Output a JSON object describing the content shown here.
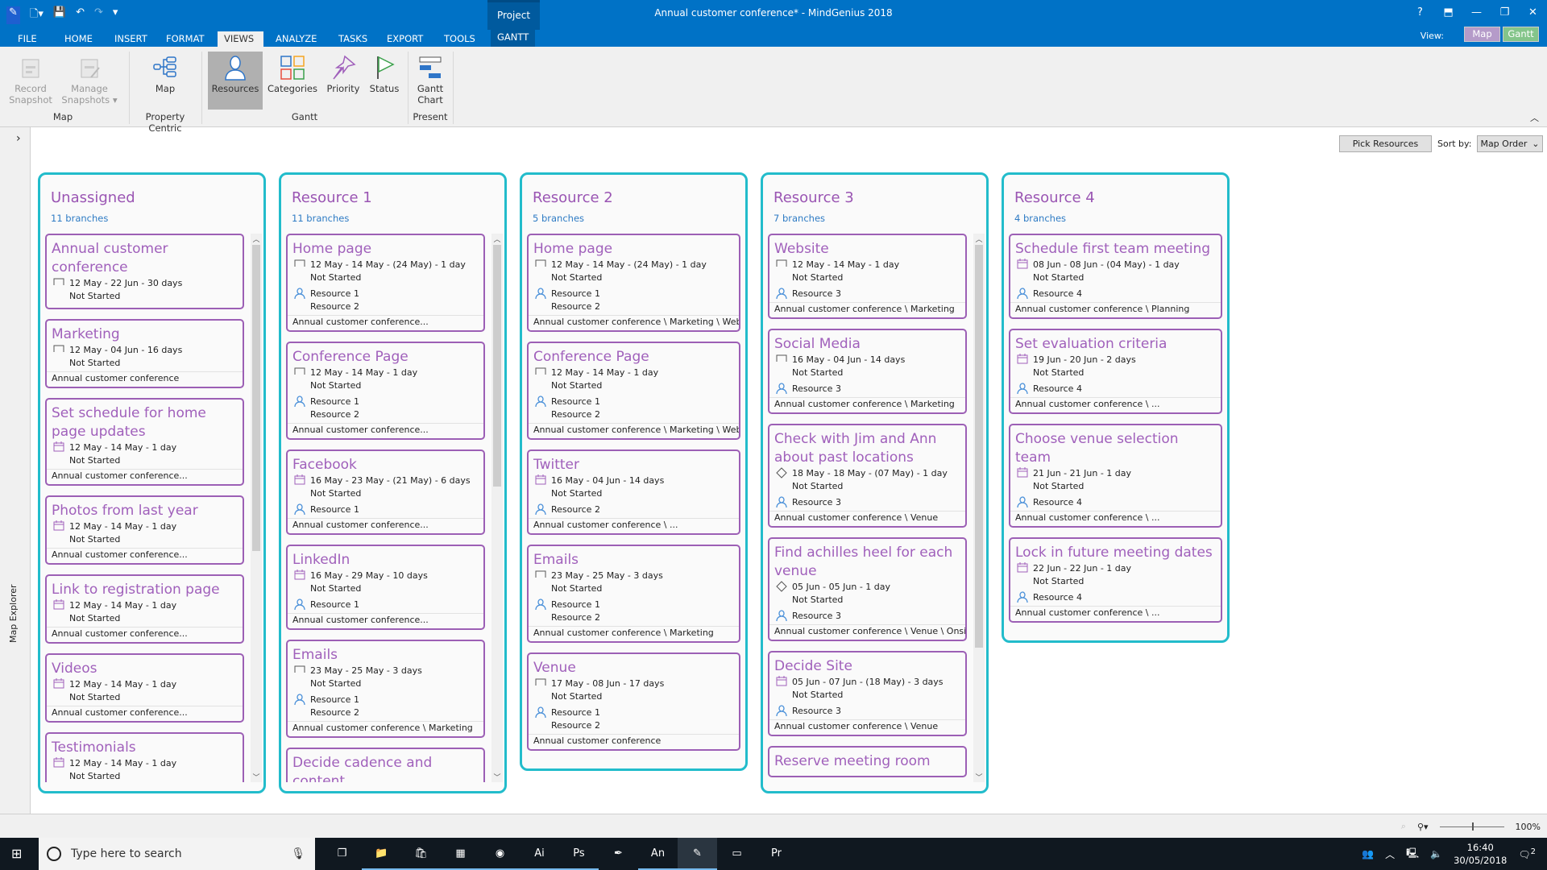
{
  "window": {
    "title": "Annual customer conference* - MindGenius 2018",
    "context_tab": "Project",
    "help": "?",
    "minimize": "—",
    "restore": "❐",
    "close": "✕"
  },
  "tabs": [
    "FILE",
    "HOME",
    "INSERT",
    "FORMAT",
    "VIEWS",
    "ANALYZE",
    "TASKS",
    "EXPORT",
    "TOOLS",
    "GANTT"
  ],
  "active_tab": "VIEWS",
  "view_switch": {
    "label": "View:",
    "map": "Map",
    "gantt": "Gantt",
    "map_color": "#b59bc9",
    "gantt_color": "#84c58a"
  },
  "ribbon": {
    "buttons": [
      {
        "label": "Record Snapshot",
        "icon": "record-snapshot-icon"
      },
      {
        "label": "Manage Snapshots ▾",
        "icon": "manage-snapshots-icon"
      },
      {
        "label": "Map",
        "icon": "map-icon"
      },
      {
        "label": "Resources",
        "icon": "person-icon",
        "selected": true
      },
      {
        "label": "Categories",
        "icon": "categories-icon"
      },
      {
        "label": "Priority",
        "icon": "pin-icon"
      },
      {
        "label": "Status",
        "icon": "flag-icon"
      },
      {
        "label": "Gantt Chart",
        "icon": "gantt-chart-icon"
      }
    ],
    "groups": [
      "Map",
      "Property Centric",
      "Gantt",
      "Present"
    ]
  },
  "explorer": {
    "label": "Map Explorer"
  },
  "toolbar": {
    "pick_resources": "Pick Resources",
    "sort_label": "Sort by:",
    "sort_value": "Map Order"
  },
  "colors": {
    "column_border": "#22bccb",
    "card_border": "#9c5fb5",
    "title": "#a060bb",
    "ribbon_blue": "#0072c6"
  },
  "columns": [
    {
      "name": "Unassigned",
      "count": "11 branches",
      "cards": [
        {
          "title": "Annual customer conference",
          "icon": "bracket",
          "dates": "12 May - 22 Jun - 30 days",
          "status": "Not Started",
          "resources": [],
          "path": ""
        },
        {
          "title": "Marketing",
          "icon": "bracket",
          "dates": "12 May - 04 Jun - 16 days",
          "status": "Not Started",
          "resources": [],
          "path": "Annual customer conference"
        },
        {
          "title": "Set schedule for home page updates",
          "icon": "calendar",
          "dates": "12 May - 14 May - 1 day",
          "status": "Not Started",
          "resources": [],
          "path": "Annual customer conference..."
        },
        {
          "title": "Photos from last year",
          "icon": "calendar",
          "dates": "12 May - 14 May - 1 day",
          "status": "Not Started",
          "resources": [],
          "path": "Annual customer conference..."
        },
        {
          "title": "Link to registration page",
          "icon": "calendar",
          "dates": "12 May - 14 May - 1 day",
          "status": "Not Started",
          "resources": [],
          "path": "Annual customer conference..."
        },
        {
          "title": "Videos",
          "icon": "calendar",
          "dates": "12 May - 14 May - 1 day",
          "status": "Not Started",
          "resources": [],
          "path": "Annual customer conference..."
        },
        {
          "title": "Testimonials",
          "icon": "calendar",
          "dates": "12 May - 14 May - 1 day",
          "status": "Not Started",
          "resources": [],
          "path": ""
        }
      ]
    },
    {
      "name": "Resource 1",
      "count": "11 branches",
      "cards": [
        {
          "title": "Home page",
          "icon": "bracket",
          "dates": "12 May - 14 May - (24 May) - 1 day",
          "status": "Not Started",
          "resources": [
            "Resource 1",
            "Resource 2"
          ],
          "path": "Annual customer conference..."
        },
        {
          "title": "Conference Page",
          "icon": "bracket",
          "dates": "12 May - 14 May - 1 day",
          "status": "Not Started",
          "resources": [
            "Resource 1",
            "Resource 2"
          ],
          "path": "Annual customer conference..."
        },
        {
          "title": "Facebook",
          "icon": "calendar",
          "dates": "16 May - 23 May - (21 May) - 6 days",
          "status": "Not Started",
          "resources": [
            "Resource 1"
          ],
          "path": "Annual customer conference..."
        },
        {
          "title": "LinkedIn",
          "icon": "calendar",
          "dates": "16 May - 29 May - 10 days",
          "status": "Not Started",
          "resources": [
            "Resource 1"
          ],
          "path": "Annual customer conference..."
        },
        {
          "title": "Emails",
          "icon": "bracket",
          "dates": "23 May - 25 May - 3 days",
          "status": "Not Started",
          "resources": [
            "Resource 1",
            "Resource 2"
          ],
          "path": "Annual customer conference \\ Marketing"
        },
        {
          "title": "Decide cadence and content",
          "icon": "bracket",
          "dates": "",
          "status": "",
          "resources": [],
          "path": ""
        }
      ]
    },
    {
      "name": "Resource 2",
      "count": "5 branches",
      "cards": [
        {
          "title": "Home page",
          "icon": "bracket",
          "dates": "12 May - 14 May - (24 May) - 1 day",
          "status": "Not Started",
          "resources": [
            "Resource 1",
            "Resource 2"
          ],
          "path": "Annual customer conference \\ Marketing \\ Website"
        },
        {
          "title": "Conference Page",
          "icon": "bracket",
          "dates": "12 May - 14 May - 1 day",
          "status": "Not Started",
          "resources": [
            "Resource 1",
            "Resource 2"
          ],
          "path": "Annual customer conference \\ Marketing \\ Website"
        },
        {
          "title": "Twitter",
          "icon": "calendar",
          "dates": "16 May - 04 Jun - 14 days",
          "status": "Not Started",
          "resources": [
            "Resource 2"
          ],
          "path": "Annual customer conference \\ ..."
        },
        {
          "title": "Emails",
          "icon": "bracket",
          "dates": "23 May - 25 May - 3 days",
          "status": "Not Started",
          "resources": [
            "Resource 1",
            "Resource 2"
          ],
          "path": "Annual customer conference \\ Marketing"
        },
        {
          "title": "Venue",
          "icon": "bracket",
          "dates": "17 May - 08 Jun - 17 days",
          "status": "Not Started",
          "resources": [
            "Resource 1",
            "Resource 2"
          ],
          "path": "Annual customer conference"
        }
      ]
    },
    {
      "name": "Resource 3",
      "count": "7 branches",
      "cards": [
        {
          "title": "Website",
          "icon": "bracket",
          "dates": "12 May - 14 May - 1 day",
          "status": "Not Started",
          "resources": [
            "Resource 3"
          ],
          "path": "Annual customer conference \\ Marketing"
        },
        {
          "title": "Social Media",
          "icon": "bracket",
          "dates": "16 May - 04 Jun - 14 days",
          "status": "Not Started",
          "resources": [
            "Resource 3"
          ],
          "path": "Annual customer conference \\ Marketing"
        },
        {
          "title": "Check with Jim and Ann about past locations",
          "icon": "diamond",
          "dates": "18 May - 18 May - (07 May) - 1 day",
          "status": "Not Started",
          "resources": [
            "Resource 3"
          ],
          "path": "Annual customer conference \\ Venue"
        },
        {
          "title": "Find achilles heel for each venue",
          "icon": "diamond",
          "dates": "05 Jun - 05 Jun - 1 day",
          "status": "Not Started",
          "resources": [
            "Resource 3"
          ],
          "path": "Annual customer conference \\ Venue \\ Onsite"
        },
        {
          "title": "Decide Site",
          "icon": "calendar",
          "dates": "05 Jun - 07 Jun - (18 May) - 3 days",
          "status": "Not Started",
          "resources": [
            "Resource 3"
          ],
          "path": "Annual customer conference \\ Venue"
        },
        {
          "title": "Reserve meeting room",
          "icon": "bracket",
          "dates": "",
          "status": "",
          "resources": [],
          "path": ""
        }
      ]
    },
    {
      "name": "Resource 4",
      "count": "4 branches",
      "cards": [
        {
          "title": "Schedule first team meeting",
          "icon": "calendar",
          "dates": "08 Jun - 08 Jun - (04 May) - 1 day",
          "status": "Not Started",
          "resources": [
            "Resource 4"
          ],
          "path": "Annual customer conference \\ Planning"
        },
        {
          "title": "Set evaluation criteria",
          "icon": "calendar",
          "dates": "19 Jun - 20 Jun - 2 days",
          "status": "Not Started",
          "resources": [
            "Resource 4"
          ],
          "path": "Annual customer conference \\ ..."
        },
        {
          "title": "Choose venue selection team",
          "icon": "calendar",
          "dates": "21 Jun - 21 Jun - 1 day",
          "status": "Not Started",
          "resources": [
            "Resource 4"
          ],
          "path": "Annual customer conference \\ ..."
        },
        {
          "title": "Lock in future meeting dates",
          "icon": "calendar",
          "dates": "22 Jun - 22 Jun - 1 day",
          "status": "Not Started",
          "resources": [
            "Resource 4"
          ],
          "path": "Annual customer conference \\ ..."
        }
      ]
    }
  ],
  "statusbar": {
    "zoom": "100%"
  },
  "taskbar": {
    "search_placeholder": "Type here to search",
    "time": "16:40",
    "date": "30/05/2018",
    "notifications": "2",
    "apps": [
      "file-explorer",
      "store",
      "app-grid",
      "chrome",
      "illustrator",
      "photoshop",
      "app",
      "animate",
      "mindgenius",
      "app",
      "premiere"
    ],
    "app_labels": [
      "📁",
      "🛍",
      "▦",
      "◉",
      "Ai",
      "Ps",
      "✒",
      "An",
      "✎",
      "▭",
      "Pr"
    ]
  }
}
